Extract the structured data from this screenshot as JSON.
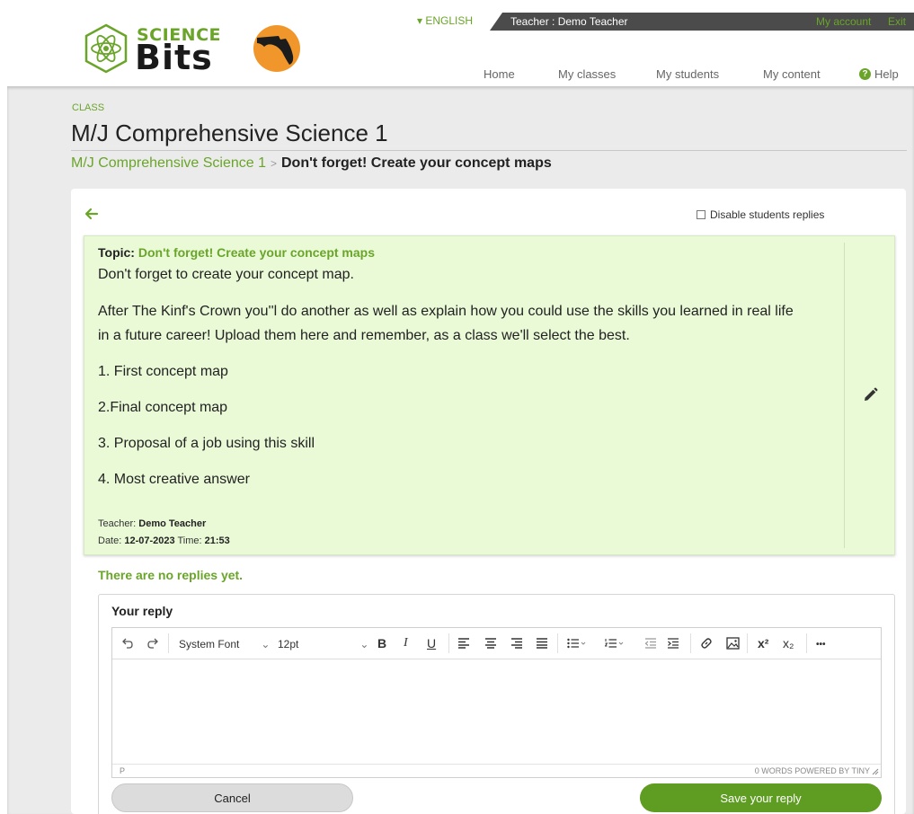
{
  "header": {
    "logo": {
      "line1": "SCIENCE",
      "line2": "Bits"
    },
    "language": "ENGLISH",
    "teacher_label": "Teacher : Demo Teacher",
    "my_account": "My account",
    "exit": "Exit",
    "nav": {
      "home": "Home",
      "my_classes": "My classes",
      "my_students": "My students",
      "my_content": "My content",
      "help": "Help"
    }
  },
  "page": {
    "section_label": "CLASS",
    "title": "M/J Comprehensive Science 1",
    "breadcrumb": {
      "parent": "M/J Comprehensive Science 1",
      "separator": ">",
      "current": "Don't forget! Create your concept maps"
    }
  },
  "topic": {
    "disable_replies_label": "Disable students replies",
    "heading_label": "Topic:",
    "heading_name": "Don't forget! Create your concept maps",
    "body": [
      "Don't forget to create your concept map.",
      "After The Kinf's Crown you''l do another as well as explain how you could use the skills you learned in real life",
      "in a future career! Upload them here and remember, as a class we'll select the best.",
      "1. First concept map",
      "2.Final concept map",
      "3. Proposal of a job using this skill",
      "4. Most creative answer"
    ],
    "teacher_label": "Teacher:",
    "teacher_name": "Demo Teacher",
    "date_label": "Date:",
    "date": "12-07-2023",
    "time_label": "Time:",
    "time": "21:53"
  },
  "replies": {
    "empty_message": "There are no replies yet.",
    "reply_title": "Your reply",
    "toolbar": {
      "font_family": "System Font",
      "font_size": "12pt",
      "bold": "B",
      "italic": "I",
      "underline": "U",
      "superscript": "x²",
      "subscript": "x₂",
      "more": "•••"
    },
    "status_path": "P",
    "status_words": "0 WORDS  POWERED BY TINY",
    "cancel_label": "Cancel",
    "save_label": "Save your reply"
  },
  "colors": {
    "brand_green": "#6aa52a",
    "topic_bg": "#eafad7",
    "save_button": "#5f9c22",
    "topbar": "#4b4b4b"
  },
  "icons": [
    "atom-logo-icon",
    "state-badge-icon",
    "help-icon",
    "back-arrow-icon",
    "pencil-icon",
    "undo-icon",
    "redo-icon",
    "align-left-icon",
    "align-center-icon",
    "align-right-icon",
    "justify-icon",
    "bullet-list-icon",
    "numbered-list-icon",
    "outdent-icon",
    "indent-icon",
    "link-icon",
    "image-icon"
  ]
}
